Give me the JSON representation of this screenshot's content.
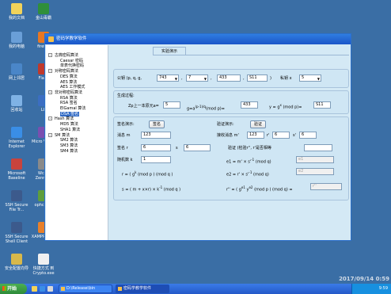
{
  "desktop": {
    "icons": [
      {
        "label": "我的文档",
        "color": "#f2d35a"
      },
      {
        "label": "金山毒霸",
        "color": "#2f8f3a"
      },
      {
        "label": "我的电脑",
        "color": "#6a9fd8"
      },
      {
        "label": "firefox",
        "color": "#e87722"
      },
      {
        "label": "网上邻居",
        "color": "#4a86c8"
      },
      {
        "label": "Flash",
        "color": "#c0392b"
      },
      {
        "label": "回收站",
        "color": "#7fb2e5"
      },
      {
        "label": "LC",
        "color": "#3b6ec2"
      },
      {
        "label": "Internet Explorer",
        "color": "#3a8ee6"
      },
      {
        "label": "Micro Visual",
        "color": "#7a4fb0"
      },
      {
        "label": "Microsoft Baseline",
        "color": "#c8433d"
      },
      {
        "label": "Wcap Zenmap",
        "color": "#8a8a8a"
      },
      {
        "label": "SSH Secure File Tr...",
        "color": "#3c5a8c"
      },
      {
        "label": "ophcrack",
        "color": "#5e9e3c"
      },
      {
        "label": "SSH Secure Shell Client",
        "color": "#3c5a8c"
      },
      {
        "label": "XAMPP Cont",
        "color": "#e8802a"
      },
      {
        "label": "安全配置向导",
        "color": "#d8b84a"
      },
      {
        "label": "快捷方式 到 Crypto.exe",
        "color": "#f0f0f0"
      }
    ]
  },
  "window": {
    "title": "密码学教学软件",
    "tab_label": "实验演示",
    "tree": [
      {
        "text": "古典密码算法",
        "toggle": "-"
      },
      {
        "text": "Caesar 密码"
      },
      {
        "text": "单表代换密码"
      },
      {
        "text": "对称密码算法",
        "toggle": "-"
      },
      {
        "text": "DES 算法"
      },
      {
        "text": "AES 算法"
      },
      {
        "text": "AES 工作模式"
      },
      {
        "text": "非对称密码算法",
        "toggle": "-"
      },
      {
        "text": "RSA 算法"
      },
      {
        "text": "RSA 签名"
      },
      {
        "text": "ElGamal 算法"
      },
      {
        "text": "DSA 签名",
        "selected": true
      },
      {
        "text": "Hash 算法",
        "toggle": "-"
      },
      {
        "text": "MD5 算法"
      },
      {
        "text": "SHA1 算法"
      },
      {
        "text": "SM 算法",
        "toggle": "-"
      },
      {
        "text": "SM2 算法"
      },
      {
        "text": "SM3 算法"
      },
      {
        "text": "SM4 算法"
      }
    ],
    "params": {
      "label": "公钥 (p, q, g,",
      "p": "743",
      "q": "7",
      "g": "433",
      "y": "S11",
      "close_paren": ")",
      "private_label": "私钥 x",
      "x": "5"
    },
    "gen": {
      "title": "生成过程:",
      "zp_label": "Zp上一本原元a=",
      "a": "5",
      "g_formula_g": "g=a",
      "g_formula_exp": "(p-1)/q",
      "g_formula_mod": "(mod p)=",
      "g_value": "433",
      "y_formula": "y = g",
      "y_exp": "x",
      "y_mod": "(mod p)=",
      "y_value": "S11"
    },
    "sign": {
      "demo_label": "签名演示:",
      "sign_button": "签名",
      "verify_label": "验证演示:",
      "verify_button": "验证",
      "message_label": "消息 m",
      "message": "123",
      "recv_label": "接收消息 m'",
      "recv_message": "123",
      "r_prime_label": "r'",
      "r_prime": "6",
      "s_prime_label": "s'",
      "s_prime": "6",
      "sig_r_label": "签名 r",
      "r": "6",
      "sig_s_label": "s",
      "s": "6",
      "verify_result_label": "验证 (检验r'', r'是否相等",
      "random_label": "随机数 k",
      "k": "1",
      "e1_formula": "e1 = m' × s'",
      "e1_exp": "-1",
      "e1_mod": "(mod q)",
      "e1_value": "e1",
      "r_formula": "r = ( g",
      "r_exp": "k",
      "r_mod": "(mod p ) (mod q )",
      "e2_formula": "e2 = r' × s'",
      "e2_exp": "-1",
      "e2_mod": "(mod q)",
      "e2_value": "e2",
      "s_formula": "s = ( m + x×r) × k",
      "s_exp": "-1",
      "s_mod": "(mod q )",
      "r2_formula": "r'' = ( g",
      "r2_exp_e1": "e1",
      "r2_mid": " y",
      "r2_exp_e2": "e2",
      "r2_mod": "(mod p ) (mod q) =",
      "r2_value": "r''"
    }
  },
  "taskbar": {
    "start": "开始",
    "buttons": [
      "D:\\Release\\bin",
      "密码学教学软件"
    ],
    "clock": "9:59"
  },
  "watermark": "2017/09/14 0:59"
}
